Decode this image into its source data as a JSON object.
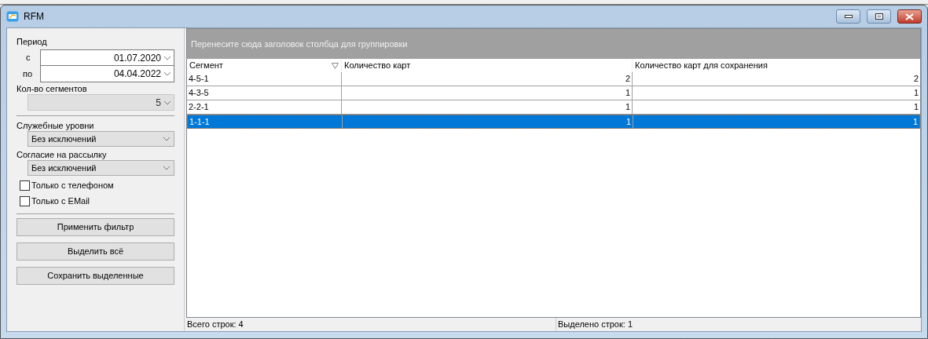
{
  "window": {
    "title": "RFM"
  },
  "filters": {
    "period_label": "Период",
    "from_label": "с",
    "from_value": "01.07.2020",
    "to_label": "по",
    "to_value": "04.04.2022",
    "segments_label": "Кол-во сегментов",
    "segments_value": "5",
    "segments_disabled": true,
    "service_levels_label": "Служебные уровни",
    "service_levels_value": "Без исключений",
    "consent_label": "Согласие на рассылку",
    "consent_value": "Без исключений",
    "checkboxes": [
      {
        "label": "Только с телефоном",
        "checked": false
      },
      {
        "label": "Только с EMail",
        "checked": false
      }
    ],
    "buttons": [
      "Применить фильтр",
      "Выделить всё",
      "Сохранить выделенные"
    ]
  },
  "grid": {
    "group_panel": "Перенесите сюда заголовок столбца для группировки",
    "columns": [
      {
        "label": "Сегмент",
        "filter": true
      },
      {
        "label": "Количество карт",
        "filter": false
      },
      {
        "label": "Количество карт для сохранения",
        "filter": false
      }
    ],
    "rows": [
      {
        "cells": [
          "4-5-1",
          "2",
          "2"
        ],
        "selected": false
      },
      {
        "cells": [
          "4-3-5",
          "1",
          "1"
        ],
        "selected": false
      },
      {
        "cells": [
          "2-2-1",
          "1",
          "1"
        ],
        "selected": false
      },
      {
        "cells": [
          "1-1-1",
          "1",
          "1"
        ],
        "selected": true
      }
    ]
  },
  "status_bar": {
    "total": "Всего строк: 4",
    "selected": "Выделено строк: 1"
  }
}
